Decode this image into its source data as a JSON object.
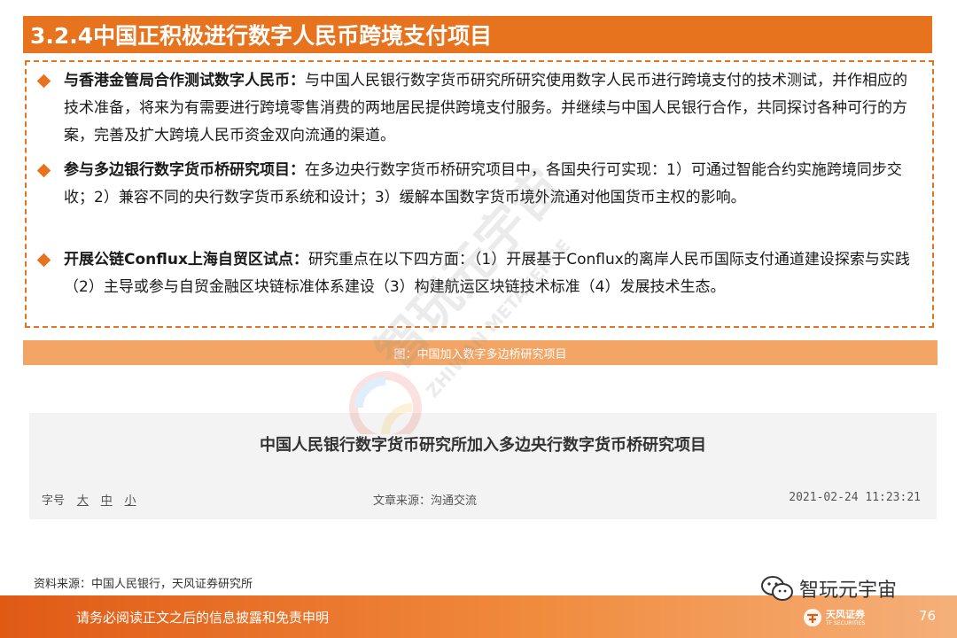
{
  "header": {
    "title": "3.2.4中国正积极进行数字人民币跨境支付项目"
  },
  "bullets": [
    {
      "head": "与香港金管局合作测试数字人民币：",
      "body": "与中国人民银行数字货币研究所研究使用数字人民币进行跨境支付的技术测试，并作相应的技术准备，将来为有需要进行跨境零售消费的两地居民提供跨境支付服务。并继续与中国人民银行合作，共同探讨各种可行的方案，完善及扩大跨境人民币资金双向流通的渠道。"
    },
    {
      "head": "参与多边银行数字货币桥研究项目：",
      "body": "在多边央行数字货币桥研究项目中，各国央行可实现：1）可通过智能合约实施跨境同步交收；2）兼容不同的央行数字货币系统和设计；3）缓解本国数字货币境外流通对他国货币主权的影响。"
    },
    {
      "head": "开展公链Conflux上海自贸区试点：",
      "body": "研究重点在以下四方面：（1）开展基于Conflux的离岸人民币国际支付通道建设探索与实践（2）主导或参与自贸金融区块链标准体系建设（3）构建航运区块链技术标准（4）发展技术生态。"
    }
  ],
  "figure": {
    "caption": "图：中国加入数字多边桥研究项目"
  },
  "news": {
    "title": "中国人民银行数字货币研究所加入多边央行数字货币桥研究项目",
    "font_size_label": "字号",
    "font_sizes": [
      "大",
      "中",
      "小"
    ],
    "source": "文章来源：沟通交流",
    "datetime": "2021-02-24 11:23:21"
  },
  "source_note": "资料来源：中国人民银行，天风证券研究所",
  "watermark": {
    "text_cn": "智玩元宇宙",
    "text_en": "ZHIWAN METAVERSE"
  },
  "wechat": {
    "label": "智玩元宇宙"
  },
  "footer": {
    "disclaimer": "请务必阅读正文之后的信息披露和免责申明",
    "brand_cn": "天风证券",
    "brand_en": "TF SECURITIES",
    "page": "76"
  },
  "colors": {
    "accent": "#e8731e",
    "caption_bg": "#f2a565",
    "panel_bg": "#f3f3f3"
  },
  "icons": [
    "diamond-bullet-icon",
    "watermark-logo-icon",
    "wechat-icon",
    "tf-securities-logo-icon"
  ]
}
